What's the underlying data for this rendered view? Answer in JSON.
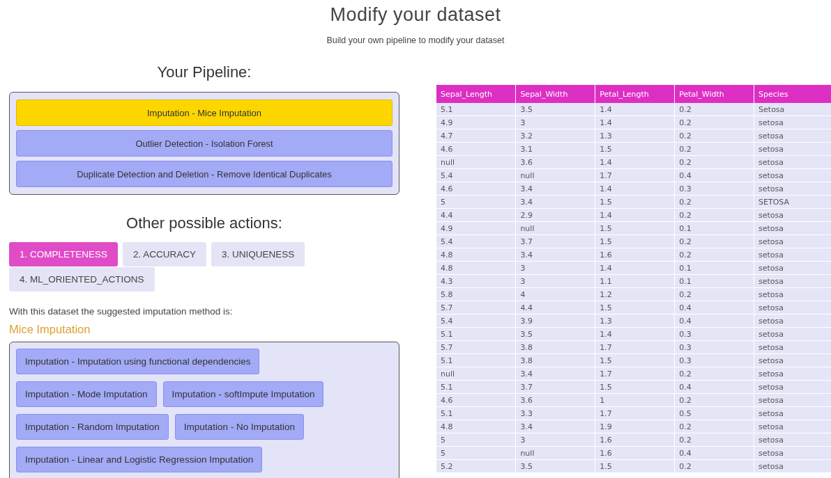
{
  "title": "Modify your dataset",
  "subtitle": "Build your own pipeline to modify your dataset",
  "pipeline": {
    "heading": "Your Pipeline:",
    "steps": [
      {
        "label": "Imputation - Mice Imputation",
        "highlighted": true
      },
      {
        "label": "Outlier Detection - Isolation Forest",
        "highlighted": false
      },
      {
        "label": "Duplicate Detection and Deletion - Remove Identical Duplicates",
        "highlighted": false
      }
    ]
  },
  "actions": {
    "heading": "Other possible actions:",
    "tabs": [
      {
        "label": "1. COMPLETENESS",
        "selected": true
      },
      {
        "label": "2. ACCURACY",
        "selected": false
      },
      {
        "label": "3. UNIQUENESS",
        "selected": false
      },
      {
        "label": "4. ML_ORIENTED_ACTIONS",
        "selected": false
      }
    ],
    "suggestion_text": "With this dataset the suggested imputation method is:",
    "suggested_method": "Mice Imputation",
    "methods": [
      "Imputation - Imputation using functional dependencies",
      "Imputation - Mode Imputation",
      "Imputation - softImpute Imputation",
      "Imputation - Random Imputation",
      "Imputation - No Imputation",
      "Imputation - Linear and Logistic Regression Imputation"
    ]
  },
  "table": {
    "columns": [
      "Sepal_Length",
      "Sepal_Width",
      "Petal_Length",
      "Petal_Width",
      "Species"
    ],
    "rows": [
      [
        "5.1",
        "3.5",
        "1.4",
        "0.2",
        "Setosa"
      ],
      [
        "4.9",
        "3",
        "1.4",
        "0.2",
        "setosa"
      ],
      [
        "4.7",
        "3.2",
        "1.3",
        "0.2",
        "setosa"
      ],
      [
        "4.6",
        "3.1",
        "1.5",
        "0.2",
        "setosa"
      ],
      [
        "null",
        "3.6",
        "1.4",
        "0.2",
        "setosa"
      ],
      [
        "5.4",
        "null",
        "1.7",
        "0.4",
        "setosa"
      ],
      [
        "4.6",
        "3.4",
        "1.4",
        "0.3",
        "setosa"
      ],
      [
        "5",
        "3.4",
        "1.5",
        "0.2",
        "SETOSA"
      ],
      [
        "4.4",
        "2.9",
        "1.4",
        "0.2",
        "setosa"
      ],
      [
        "4.9",
        "null",
        "1.5",
        "0.1",
        "setosa"
      ],
      [
        "5.4",
        "3.7",
        "1.5",
        "0.2",
        "setosa"
      ],
      [
        "4.8",
        "3.4",
        "1.6",
        "0.2",
        "setosa"
      ],
      [
        "4.8",
        "3",
        "1.4",
        "0.1",
        "setosa"
      ],
      [
        "4.3",
        "3",
        "1.1",
        "0.1",
        "setosa"
      ],
      [
        "5.8",
        "4",
        "1.2",
        "0.2",
        "setosa"
      ],
      [
        "5.7",
        "4.4",
        "1.5",
        "0.4",
        "setosa"
      ],
      [
        "5.4",
        "3.9",
        "1.3",
        "0.4",
        "setosa"
      ],
      [
        "5.1",
        "3.5",
        "1.4",
        "0.3",
        "setosa"
      ],
      [
        "5.7",
        "3.8",
        "1.7",
        "0.3",
        "setosa"
      ],
      [
        "5.1",
        "3.8",
        "1.5",
        "0.3",
        "setosa"
      ],
      [
        "null",
        "3.4",
        "1.7",
        "0.2",
        "setosa"
      ],
      [
        "5.1",
        "3.7",
        "1.5",
        "0.4",
        "setosa"
      ],
      [
        "4.6",
        "3.6",
        "1",
        "0.2",
        "setosa"
      ],
      [
        "5.1",
        "3.3",
        "1.7",
        "0.5",
        "setosa"
      ],
      [
        "4.8",
        "3.4",
        "1.9",
        "0.2",
        "setosa"
      ],
      [
        "5",
        "3",
        "1.6",
        "0.2",
        "setosa"
      ],
      [
        "5",
        "null",
        "1.6",
        "0.4",
        "setosa"
      ],
      [
        "5.2",
        "3.5",
        "1.5",
        "0.2",
        "setosa"
      ]
    ]
  }
}
